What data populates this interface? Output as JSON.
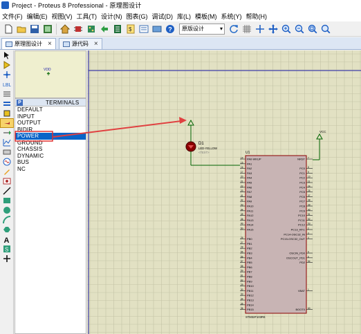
{
  "window": {
    "title": "Project - Proteus 8 Professional - 原理图设计"
  },
  "menus": [
    "文件(F)",
    "编辑(E)",
    "视图(V)",
    "工具(T)",
    "设计(N)",
    "图表(G)",
    "调试(D)",
    "库(L)",
    "模板(M)",
    "系统(Y)",
    "帮助(H)"
  ],
  "toolbar": {
    "combo_value": "原版设计",
    "icons": [
      "new-icon",
      "open-icon",
      "save-icon",
      "close-icon",
      "home-icon",
      "schematic-icon",
      "pcb-icon",
      "gerber-icon",
      "bom-icon",
      "source-icon",
      "design-explorer-icon",
      "3d-icon",
      "help-icon"
    ]
  },
  "tabs": [
    {
      "label": "原理图设计",
      "active": true
    },
    {
      "label": "源代码",
      "active": false
    }
  ],
  "panel": {
    "mode_button": "P",
    "title": "TERMINALS",
    "items": [
      "DEFAULT",
      "INPUT",
      "OUTPUT",
      "BIDIR",
      "POWER",
      "GROUND",
      "CHASSIS",
      "DYNAMIC",
      "BUS",
      "NC"
    ],
    "selected": "POWER"
  },
  "overview": {
    "label": "VDD"
  },
  "schematic": {
    "led": {
      "ref": "D1",
      "part": "LED-YELLOW",
      "text": "<TEXT>"
    },
    "power_label": "VCC",
    "mcu": {
      "ref": "U1",
      "part": "STM32F103R6",
      "left_pins": [
        "PA0-WKUP",
        "PA1",
        "PA2",
        "PA3",
        "PA4",
        "PA5",
        "PA6",
        "PA7",
        "PA8",
        "PA9",
        "PA10",
        "PA11",
        "PA12",
        "PA13",
        "PA14",
        "PA15",
        "",
        "PB0",
        "PB1",
        "PB2",
        "PB3",
        "PB4",
        "PB5",
        "PB6",
        "PB7",
        "PB8",
        "PB9",
        "PB10",
        "PB11",
        "PB12",
        "PB13",
        "PB14",
        "PB15"
      ],
      "left_nums": [
        "14",
        "15",
        "16",
        "17",
        "20",
        "21",
        "22",
        "23",
        "41",
        "42",
        "43",
        "44",
        "45",
        "46",
        "49",
        "50",
        "",
        "26",
        "27",
        "28",
        "55",
        "56",
        "57",
        "58",
        "59",
        "61",
        "62",
        "29",
        "30",
        "33",
        "34",
        "35",
        "36"
      ],
      "right_pins": [
        "NRST",
        "",
        "PC0",
        "PC1",
        "PC2",
        "PC3",
        "PC4",
        "PC5",
        "PC6",
        "PC7",
        "PC8",
        "PC9",
        "PC10",
        "PC11",
        "PC12",
        "PC13_RTC",
        "PC14-OSC32_IN",
        "PC15-OSC32_OUT",
        "",
        "",
        "OSCIN_PD0",
        "OSCOUT_PD1",
        "PD2",
        "",
        "",
        "",
        "",
        "",
        "VBAT",
        "",
        "",
        "",
        "BOOT0"
      ],
      "right_nums": [
        "7",
        "",
        "8",
        "9",
        "10",
        "11",
        "24",
        "25",
        "37",
        "38",
        "39",
        "40",
        "51",
        "52",
        "53",
        "2",
        "3",
        "4",
        "",
        "",
        "5",
        "6",
        "54",
        "",
        "",
        "",
        "",
        "",
        "1",
        "",
        "",
        "",
        "60"
      ]
    }
  },
  "colors": {
    "canvas_bg": "#e2e1c3",
    "grid": "#c4c3a6",
    "wire": "#006400",
    "sheet_line": "#1c1caa",
    "part_fill": "#c8b4b4",
    "part_border": "#8b0000",
    "annotation_arrow": "#e04040",
    "highlight_box": "#e03030"
  }
}
